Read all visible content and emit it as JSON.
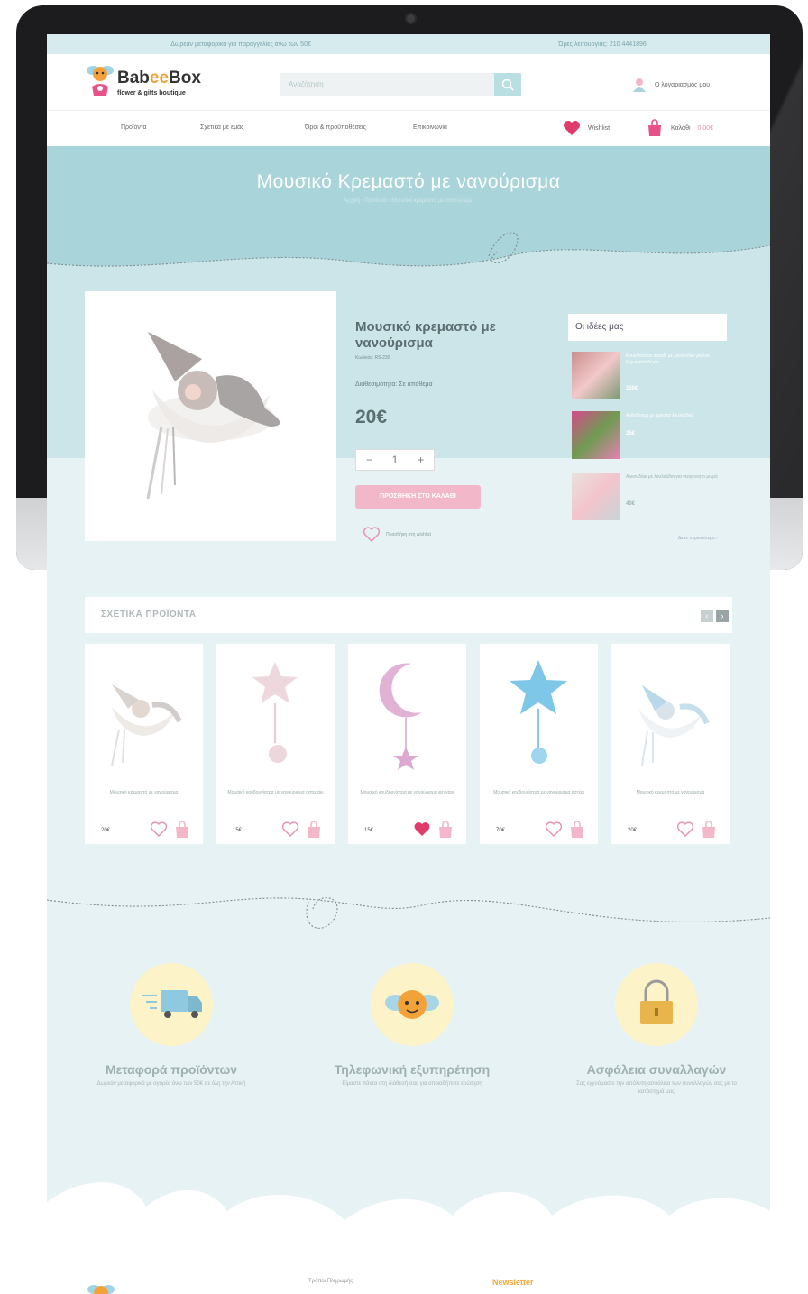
{
  "topbar": {
    "left": "Δωρεάν μεταφορικά για παραγγελίες άνω των 50€",
    "right": "Ώρες λειτουργίας: 210 4441896"
  },
  "logo": {
    "brand_a": "Bab",
    "brand_b": "ee",
    "brand_c": "Box",
    "tagline": "flower & gifts boutique"
  },
  "search": {
    "placeholder": "Αναζήτηση"
  },
  "account": {
    "label": "Ο λογαριασμός μου"
  },
  "nav": {
    "items": [
      "Προϊόντα",
      "Σχετικά με εμάς",
      "Όροι & προϋποθέσεις",
      "Επικοινωνία"
    ],
    "wishlist": "Wishlist",
    "cart_label": "Καλάθι",
    "cart_price": "0.00€"
  },
  "hero": {
    "title": "Μουσικό Κρεμαστό με νανούρισμα",
    "breadcrumb": "Αρχική › Προϊόντα › Μουσικό κρεμαστό με νανούρισμα"
  },
  "product": {
    "title": "Μουσικό κρεμαστό με νανούρισμα",
    "code": "Κωδικός: RS-230",
    "availability": "Διαθεσιμότητα: Σε απόθεμα",
    "price": "20€",
    "qty_minus": "−",
    "qty_value": "1",
    "qty_plus": "+",
    "add_to_cart": "ΠΡΟΣΘΗΚΗ ΣΤΟ ΚΑΛΑΘΙ",
    "wishlist": "Προσθήκη στη wishlist"
  },
  "ideas": {
    "title": "Οι ιδέες μας",
    "items": [
      {
        "text": "Κουκλίτσα σε καλάθι με λουλούδια για ένα ξεχωριστό δώρο",
        "price": "150€"
      },
      {
        "text": "Ανθοδέσμη με φρέσκα λουλούδια",
        "price": "25€"
      },
      {
        "text": "Αρκουδάκι με λουλούδια για νεογέννητο μωρό",
        "price": "40€"
      }
    ],
    "more": "Δείτε περισσότερα ›"
  },
  "related": {
    "title": "ΣΧΕΤΙΚΑ ΠΡΟΪΟΝΤΑ",
    "prev": "‹",
    "next": "›",
    "items": [
      {
        "name": "Μουσικό κρεμαστό με νανούρισμα",
        "price": "20€",
        "liked": false
      },
      {
        "name": "Μουσικό κουδουνίστρα με νανούρισμα αστεράκι",
        "price": "15€",
        "liked": false
      },
      {
        "name": "Μουσικό κουδουνίστρα με νανούρισμα φεγγάρι",
        "price": "15€",
        "liked": true
      },
      {
        "name": "Μουσικό κουδουνίστρα με νανούρισμα αστέρι",
        "price": "70€",
        "liked": false
      },
      {
        "name": "Μουσικό κρεμαστό με νανούρισμα",
        "price": "20€",
        "liked": false
      }
    ]
  },
  "features": [
    {
      "title": "Μεταφορά προϊόντων",
      "desc": "Δωρεάν μεταφορικά με αγορές άνω των 50€ σε όλη την Αττική"
    },
    {
      "title": "Τηλεφωνική εξυπηρέτηση",
      "desc": "Είμαστε πάντα στη διάθεσή σας για οποιαδήποτε ερώτηση"
    },
    {
      "title": "Ασφάλεια συναλλαγών",
      "desc": "Σας εγγυόμαστε την απόλυτη ασφάλεια των συναλλαγών σας με το κατάστημά μας"
    }
  ],
  "footer": {
    "info": "Τρόποι Πληρωμής",
    "newsletter": "Newsletter"
  },
  "colors": {
    "accent": "#a9d4d9",
    "pink": "#f2b8c9",
    "heart": "#e13b6b",
    "orange": "#f4a93c"
  }
}
